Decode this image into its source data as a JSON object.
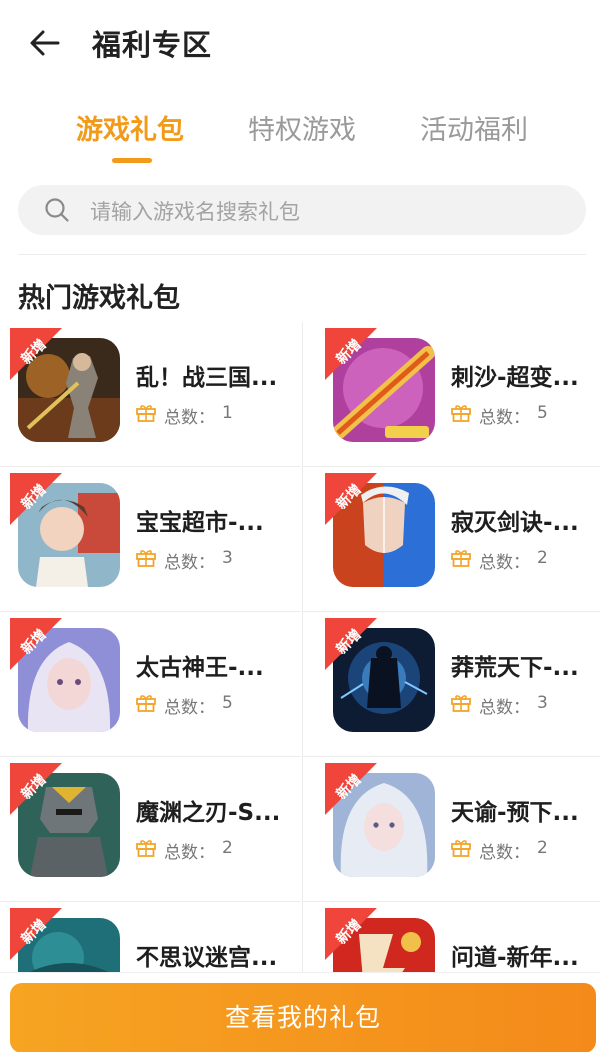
{
  "header": {
    "title": "福利专区"
  },
  "tabs": [
    {
      "label": "游戏礼包",
      "active": true
    },
    {
      "label": "特权游戏",
      "active": false
    },
    {
      "label": "活动福利",
      "active": false
    }
  ],
  "search": {
    "placeholder": "请输入游戏名搜索礼包"
  },
  "section": {
    "title": "热门游戏礼包"
  },
  "badge_label": "新增",
  "count_label": "总数：",
  "games": [
    {
      "name": "乱！战三国...",
      "count": "1"
    },
    {
      "name": "刺沙-超变...",
      "count": "5"
    },
    {
      "name": "宝宝超市-...",
      "count": "3"
    },
    {
      "name": "寂灭剑诀-...",
      "count": "2"
    },
    {
      "name": "太古神王-...",
      "count": "5"
    },
    {
      "name": "莽荒天下-...",
      "count": "3"
    },
    {
      "name": "魔渊之刃-S...",
      "count": "2"
    },
    {
      "name": "天谕-预下...",
      "count": "2"
    },
    {
      "name": "不思议迷宫...",
      "count": ""
    },
    {
      "name": "问道-新年...",
      "count": ""
    }
  ],
  "cta": {
    "label": "查看我的礼包"
  },
  "colors": {
    "accent": "#f29a19",
    "badge": "#f0453a",
    "cta_start": "#f6a422",
    "cta_end": "#f48a1a"
  }
}
